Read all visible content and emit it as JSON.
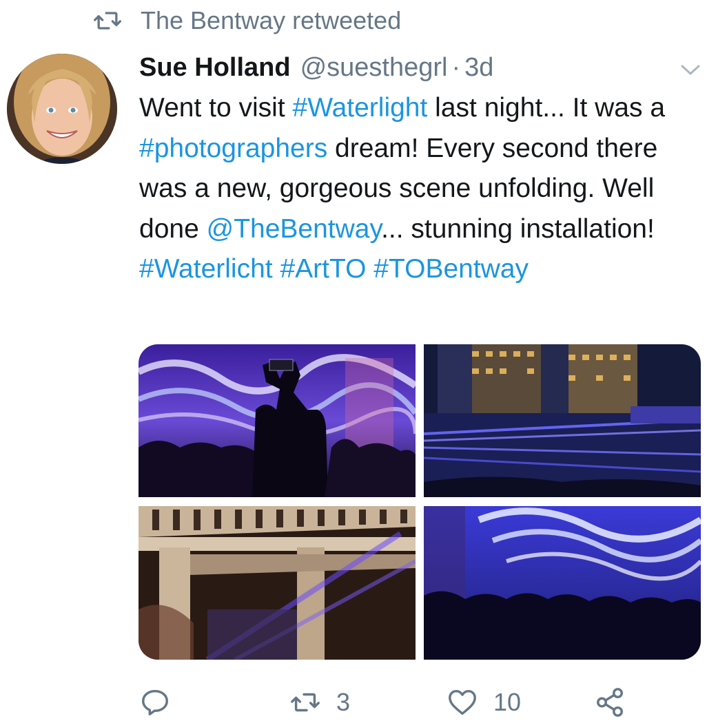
{
  "retweet_context": {
    "icon": "retweet-icon",
    "text": "The Bentway retweeted"
  },
  "tweet": {
    "avatar_alt": "Sue Holland avatar",
    "display_name": "Sue Holland",
    "handle": "@suesthegrl",
    "separator": "·",
    "time": "3d",
    "menu_icon": "chevron-down-icon",
    "text_parts": {
      "t1": "Went to visit ",
      "h1": "#Waterlight",
      "t2": " last night... It was a ",
      "h2": "#photographers",
      "t3": " dream! Every second there was a new, gorgeous scene unfolding. Well done ",
      "m1": "@TheBentway",
      "t4": "... stunning installation! ",
      "h3": "#Waterlicht",
      "t5": " ",
      "h4": "#ArtTO",
      "t6": " ",
      "h5": "#TOBentway"
    },
    "photos": [
      "photo-person-filming-light-waves",
      "photo-lasers-city-night",
      "photo-bridge-underside-lasers",
      "photo-crowd-light-waves"
    ]
  },
  "actions": {
    "reply": {
      "icon": "reply-icon",
      "count": ""
    },
    "retweet": {
      "icon": "retweet-icon",
      "count": "3"
    },
    "like": {
      "icon": "heart-icon",
      "count": "10"
    },
    "share": {
      "icon": "share-icon",
      "count": ""
    }
  },
  "colors": {
    "link": "#1b95e0",
    "secondary_text": "#657786",
    "primary_text": "#14171a",
    "background": "#ffffff"
  }
}
